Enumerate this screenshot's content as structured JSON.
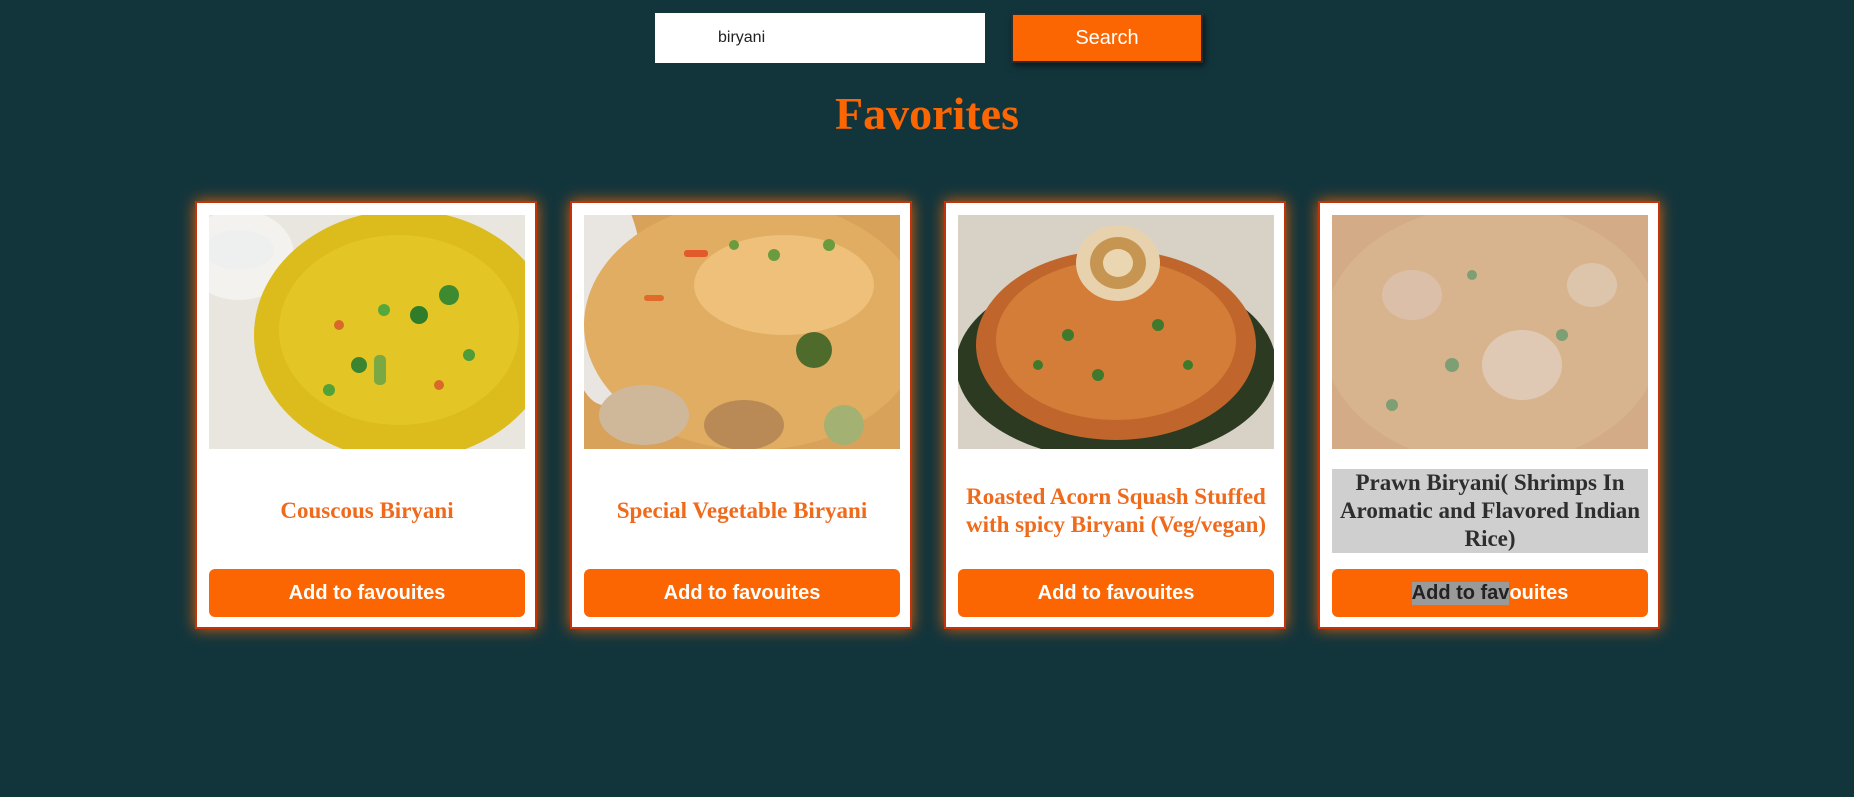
{
  "search": {
    "value": "biryani",
    "placeholder": "",
    "button_label": "Search"
  },
  "page": {
    "title": "Favorites"
  },
  "cards": [
    {
      "title": "Couscous Biryani",
      "button_label": "Add to favouites",
      "image": "couscous-biryani-photo"
    },
    {
      "title": "Special Vegetable Biryani",
      "button_label": "Add to favouites",
      "image": "vegetable-biryani-photo"
    },
    {
      "title": "Roasted Acorn Squash Stuffed with spicy Biryani (Veg/vegan)",
      "button_label": "Add to favouites",
      "image": "acorn-squash-biryani-photo"
    },
    {
      "title": "Prawn Biryani( Shrimps In Aromatic and Flavored Indian Rice)",
      "button_label_selected_part": "Add to fav",
      "button_label_rest": "ouites",
      "image": "prawn-biryani-photo"
    }
  ],
  "colors": {
    "background": "#12353c",
    "accent": "#fc6602",
    "card_border": "#c0330b",
    "title_text": "#f06a1c"
  }
}
